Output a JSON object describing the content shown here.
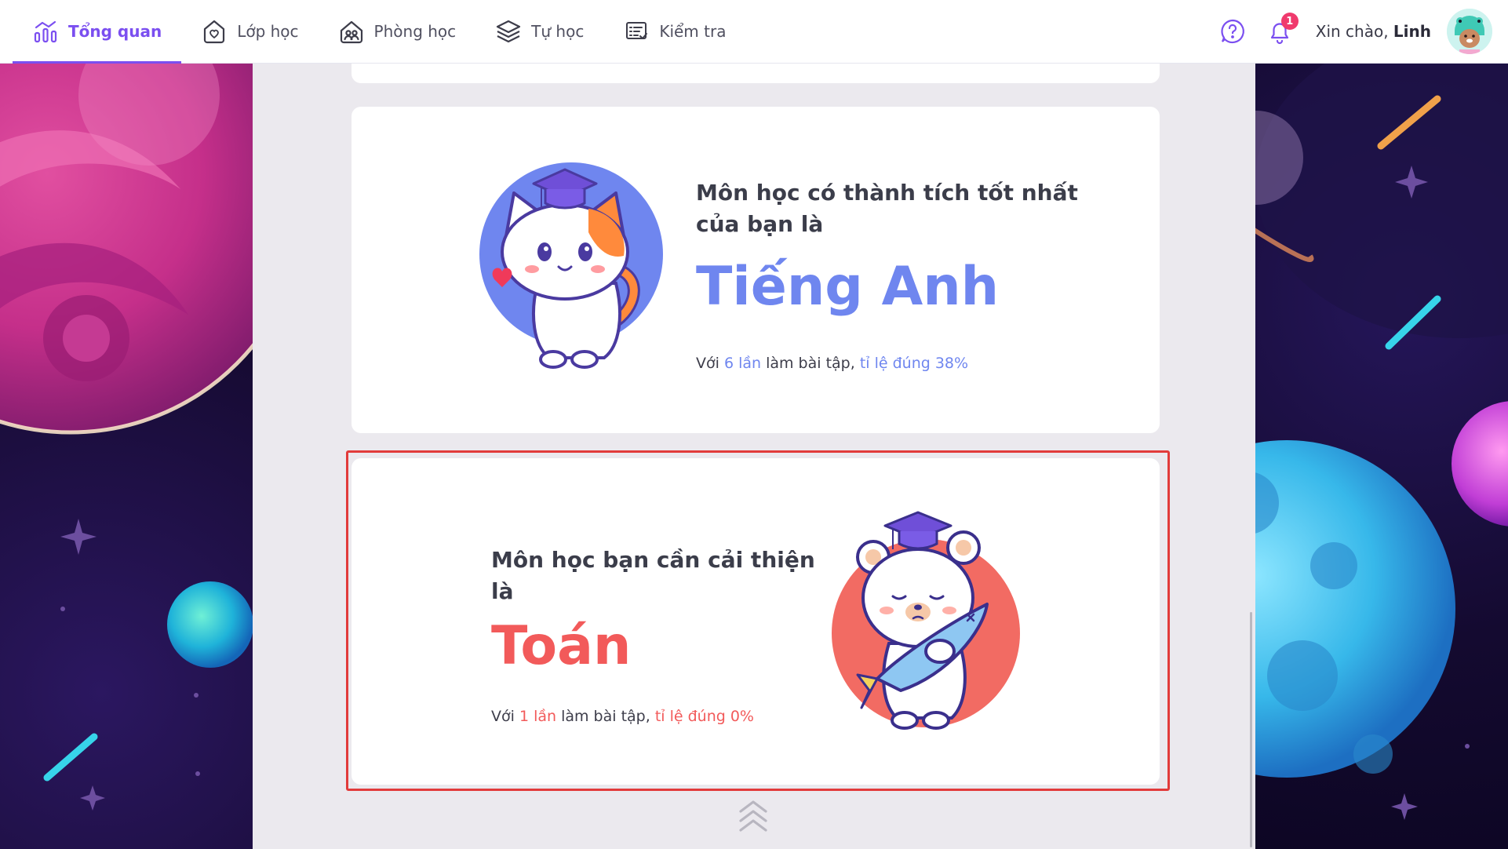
{
  "nav": {
    "items": [
      {
        "label": "Tổng quan",
        "icon": "chart-icon",
        "active": true
      },
      {
        "label": "Lớp học",
        "icon": "class-heart-icon",
        "active": false
      },
      {
        "label": "Phòng học",
        "icon": "classroom-people-icon",
        "active": false
      },
      {
        "label": "Tự học",
        "icon": "layers-icon",
        "active": false
      },
      {
        "label": "Kiểm tra",
        "icon": "test-checklist-icon",
        "active": false
      }
    ]
  },
  "header": {
    "notification_count": "1",
    "greeting_prefix": "Xin chào, ",
    "user_name": "Linh"
  },
  "best": {
    "heading": "Môn học có thành tích tốt nhất của bạn là",
    "subject": "Tiếng Anh",
    "prefix": "Với ",
    "count": "6 lần",
    "middle": " làm bài tập, ",
    "rate": "tỉ lệ đúng 38%"
  },
  "weak": {
    "heading": "Môn học bạn cần cải thiện là",
    "subject": "Toán",
    "prefix": "Với ",
    "count": "1 lần",
    "middle": " làm bài tập, ",
    "rate": "tỉ lệ đúng 0%"
  },
  "colors": {
    "accent": "#7b4ff0",
    "best": "#6f86ef",
    "weak": "#f25a5a",
    "highlight": "#e23b3b"
  }
}
